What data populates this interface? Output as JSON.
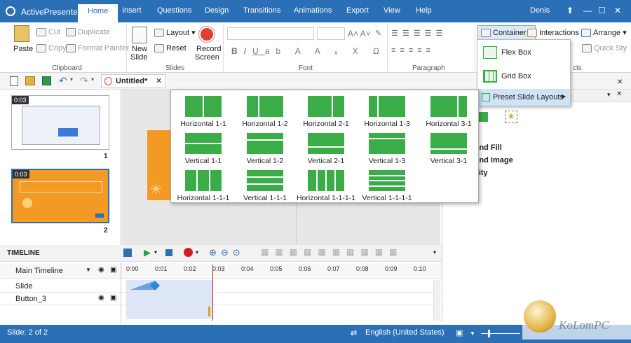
{
  "app": {
    "name": "ActivePresenter",
    "user": "Denis"
  },
  "tabs": [
    "Home",
    "Insert",
    "Questions",
    "Design",
    "Transitions",
    "Animations",
    "Export",
    "View",
    "Help"
  ],
  "ribbon": {
    "clipboard": {
      "paste": "Paste",
      "cut": "Cut",
      "copy": "Copy",
      "duplicate": "Duplicate",
      "format_painter": "Format Painter",
      "group": "Clipboard"
    },
    "slides": {
      "new_slide": "New",
      "new_slide2": "Slide",
      "layout": "Layout",
      "reset": "Reset",
      "group": "Slides"
    },
    "record": {
      "line1": "Record",
      "line2": "Screen"
    },
    "font": {
      "group": "Font"
    },
    "paragraph": {
      "group": "Paragraph"
    },
    "container": "Container",
    "interactions": "Interactions",
    "arrange": "Arrange",
    "quick_style": "Quick Sty",
    "objects_group_partial": "cts"
  },
  "container_menu": {
    "items": [
      "Flex Box",
      "Grid Box",
      "Preset Slide Layouts"
    ]
  },
  "document": {
    "tab": "Untitled*"
  },
  "slides": [
    {
      "number": "1",
      "time": "0:03"
    },
    {
      "number": "2",
      "time": "0:03"
    }
  ],
  "layouts": [
    [
      "Horizontal 1-1",
      "Horizontal 1-2",
      "Horizontal 2-1",
      "Horizontal 1-3",
      "Horizontal 3-1"
    ],
    [
      "Vertical 1-1",
      "Vertical 1-2",
      "Vertical 2-1",
      "Vertical 1-3",
      "Vertical 3-1"
    ],
    [
      "Horizontal 1-1-1",
      "Vertical 1-1-1",
      "Horizontal 1-1-1-1",
      "Vertical 1-1-1-1"
    ]
  ],
  "properties": [
    "d",
    "ound Fill",
    "ound Image",
    "bility"
  ],
  "timeline": {
    "title": "TIMELINE",
    "main": "Main Timeline",
    "rows": [
      "Slide",
      "Button_3"
    ],
    "ruler": [
      "0:00",
      "0:01",
      "0:02",
      "0:03",
      "0:04",
      "0:05",
      "0:06",
      "0:07",
      "0:08",
      "0:09",
      "0:10"
    ]
  },
  "status": {
    "slide": "Slide: 2 of 2",
    "language": "English (United States)"
  },
  "watermark": "KoLomPC",
  "colors": {
    "accent": "#2b6fb6",
    "layout_green": "#3aad48",
    "slide_orange": "#f39a24"
  }
}
